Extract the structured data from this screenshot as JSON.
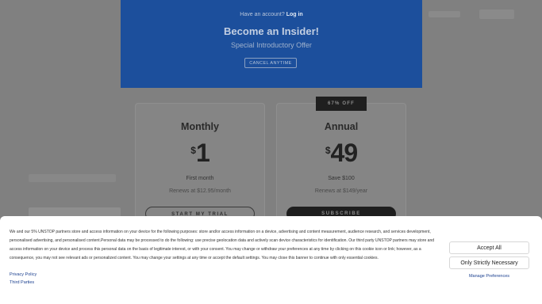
{
  "hero": {
    "have_account": "Have an account?",
    "login": "Log in",
    "title": "Become an Insider!",
    "subtitle": "Special Introductory Offer",
    "cancel": "CANCEL ANYTIME"
  },
  "badge": "67% OFF",
  "plans": {
    "monthly": {
      "name": "Monthly",
      "currency": "$",
      "amount": "1",
      "note1": "First month",
      "note2": "Renews at $12.95/month",
      "cta": "START MY TRIAL"
    },
    "annual": {
      "name": "Annual",
      "currency": "$",
      "amount": "49",
      "note1": "Save $100",
      "note2": "Renews at $149/year",
      "cta": "SUBSCRIBE"
    }
  },
  "consent": {
    "text": "We and our 5% UNSTOP partners store and access information on your device for the following purposes: store and/or access information on a device, advertising and content measurement, audience research, and services development, personalised advertising, and personalised content.Personal data may be processed to do the following: use precise geolocation data and actively scan device characteristics for identification. Our third party UNSTOP partners may store and access information on your device and process this personal data on the basis of legitimate interest, or with your consent. You may change or withdraw your preferences at any time by clicking on this cookie icon or link; however, as a consequence, you may not see relevant ads or personalized content. You may change your settings at any time or accept the default settings. You may close this banner to continue with only essential cookies.",
    "privacy_policy": "Privacy Policy",
    "third_parties": "Third Parties",
    "accept_all": "Accept All",
    "strictly_necessary": "Only Strictly Necessary",
    "manage_preferences": "Manage Preferences"
  }
}
